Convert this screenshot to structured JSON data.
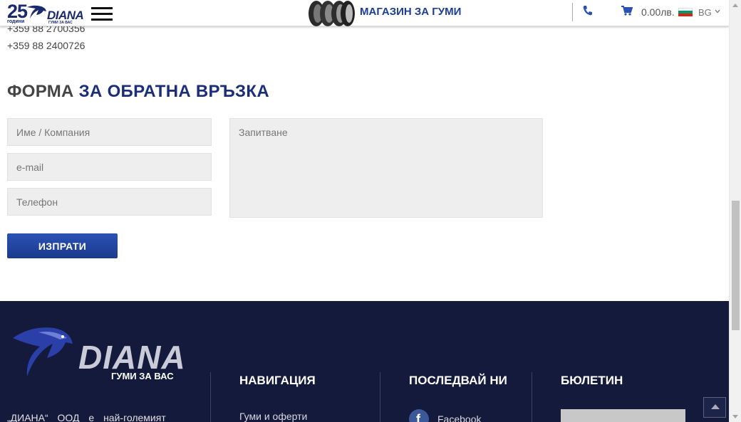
{
  "contact": {
    "phones": [
      "+359 88 2700356",
      "+359 88 2400726"
    ]
  },
  "header": {
    "logo": {
      "years_number": "25",
      "years_label": "години",
      "brand": "DIANA",
      "tagline": "ГУМИ ЗА ВАС"
    },
    "shop_link": "МАГАЗИН ЗА ГУМИ",
    "cart_total": "0.00лв.",
    "language": "BG"
  },
  "form": {
    "title_plain": "ФОРМА",
    "title_accent": "ЗА ОБРАТНА ВРЪЗКА",
    "name_placeholder": "Име / Компания",
    "email_placeholder": "e-mail",
    "phone_placeholder": "Телефон",
    "message_placeholder": "Запитване",
    "submit_label": "ИЗПРАТИ"
  },
  "footer": {
    "logo": {
      "brand": "DIANA",
      "tagline": "ГУМИ ЗА ВАС"
    },
    "about_text": "„ДИАНА“ ООД е най-големият",
    "navigation": {
      "title": "НАВИГАЦИЯ",
      "links": [
        "Гуми и оферти"
      ]
    },
    "follow": {
      "title": "ПОСЛЕДВАЙ НИ",
      "links": [
        "Facebook"
      ]
    },
    "newsletter": {
      "title": "БЮЛЕТИН"
    }
  },
  "colors": {
    "brand_blue": "#1a2e7a",
    "footer_bg": "#131a3c",
    "button_blue": "#2a52b5"
  }
}
